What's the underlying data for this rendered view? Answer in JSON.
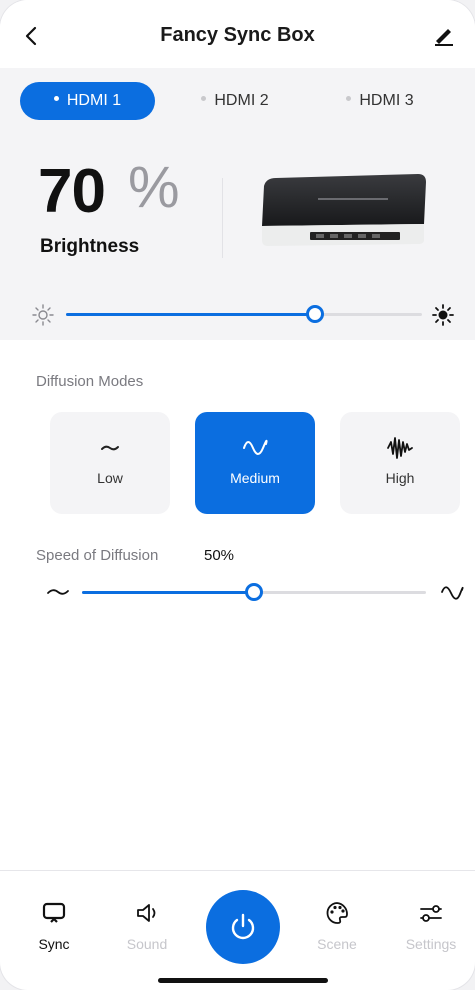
{
  "header": {
    "title": "Fancy Sync Box"
  },
  "hdmi_tabs": [
    {
      "label": "HDMI 1",
      "active": true
    },
    {
      "label": "HDMI 2",
      "active": false
    },
    {
      "label": "HDMI 3",
      "active": false
    }
  ],
  "brightness": {
    "value": "70",
    "unit": "%",
    "label": "Brightness",
    "level": 0.7
  },
  "diffusion": {
    "section_label": "Diffusion Modes",
    "modes": [
      {
        "label": "Low",
        "icon": "wave-low-icon",
        "active": false
      },
      {
        "label": "Medium",
        "icon": "wave-medium-icon",
        "active": true
      },
      {
        "label": "High",
        "icon": "wave-high-icon",
        "active": false
      }
    ]
  },
  "speed": {
    "label": "Speed of Diffusion",
    "value": "50%",
    "level": 0.5
  },
  "nav": {
    "items": [
      {
        "label": "Sync",
        "icon": "display-icon",
        "active": true
      },
      {
        "label": "Sound",
        "icon": "speaker-icon",
        "active": false
      },
      {
        "label": "Scene",
        "icon": "palette-icon",
        "active": false
      },
      {
        "label": "Settings",
        "icon": "sliders-icon",
        "active": false
      }
    ],
    "power_icon": "power-icon"
  },
  "colors": {
    "accent": "#0b6ee0",
    "panel": "#f4f4f6",
    "muted_text": "#7a7a80",
    "inactive_nav": "#c6c6cb"
  }
}
